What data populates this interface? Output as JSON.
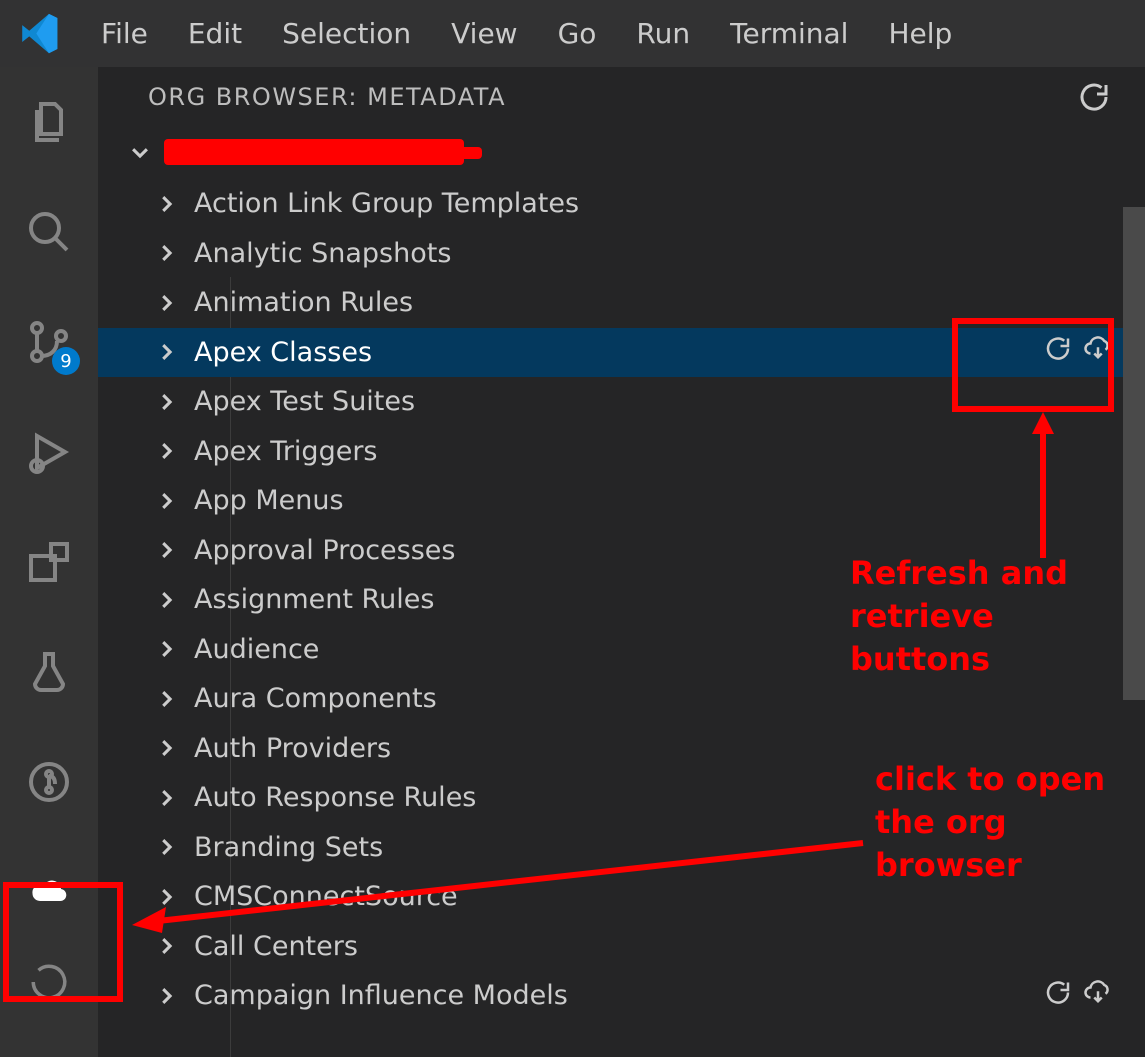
{
  "menu": {
    "items": [
      "File",
      "Edit",
      "Selection",
      "View",
      "Go",
      "Run",
      "Terminal",
      "Help"
    ]
  },
  "activitybar": {
    "badge_scm": "9"
  },
  "panel": {
    "title": "ORG BROWSER: METADATA"
  },
  "tree": {
    "items": [
      "Action Link Group Templates",
      "Analytic Snapshots",
      "Animation Rules",
      "Apex Classes",
      "Apex Test Suites",
      "Apex Triggers",
      "App Menus",
      "Approval Processes",
      "Assignment Rules",
      "Audience",
      "Aura Components",
      "Auth Providers",
      "Auto Response Rules",
      "Branding Sets",
      "CMSConnectSource",
      "Call Centers",
      "Campaign Influence Models"
    ],
    "selected_index": 3,
    "hover_index": 16
  },
  "annotations": {
    "refresh_label": "Refresh and retrieve buttons",
    "open_label": "click to open the org browser"
  }
}
